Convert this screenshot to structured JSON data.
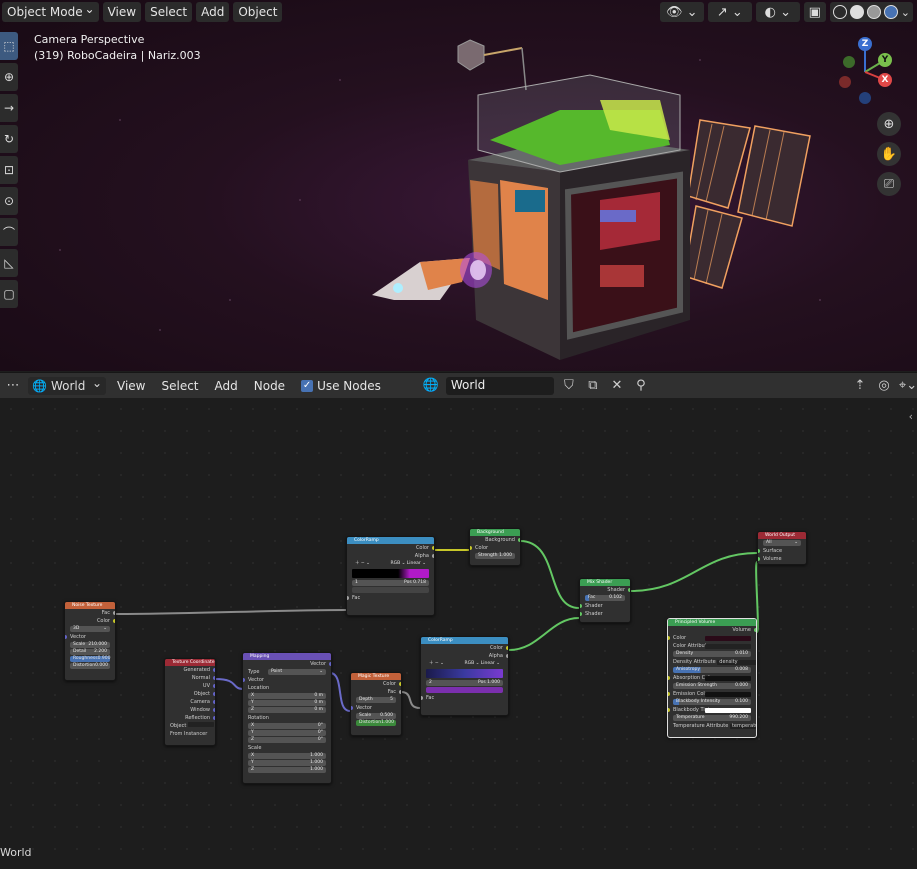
{
  "viewport": {
    "mode_select": "Object Mode",
    "menu": [
      "View",
      "Select",
      "Add",
      "Object"
    ],
    "camera_label": "Camera Perspective",
    "object_label": "(319) RoboCadeira | Nariz.003",
    "gizmo": {
      "z": "Z",
      "y": "Y",
      "x": "X"
    }
  },
  "node_editor": {
    "type_select": "World",
    "menu": [
      "View",
      "Select",
      "Add",
      "Node"
    ],
    "use_nodes_label": "Use Nodes",
    "world_name": "World",
    "footer_label": "World"
  },
  "nodes": {
    "noise": {
      "title": "Noise Texture",
      "out_fac": "Fac",
      "out_color": "Color",
      "dim": "3D",
      "in_vector": "Vector",
      "scale": "Scale",
      "scale_val": "210.000",
      "detail": "Detail",
      "detail_val": "2.200",
      "roughness": "Roughness",
      "roughness_val": "0.900",
      "distortion": "Distortion",
      "distortion_val": "0.000"
    },
    "texcoord": {
      "title": "Texture Coordinate",
      "outs": [
        "Generated",
        "Normal",
        "UV",
        "Object",
        "Camera",
        "Window",
        "Reflection"
      ],
      "object": "Object",
      "from_instancer": "From Instancer"
    },
    "mapping": {
      "title": "Mapping",
      "out_vector": "Vector",
      "type": "Type",
      "type_val": "Point",
      "in_vector": "Vector",
      "location": "Location",
      "rotation": "Rotation",
      "scale": "Scale",
      "x": "X",
      "y": "Y",
      "z": "Z",
      "loc_vals": [
        "0 m",
        "0 m",
        "0 m"
      ],
      "rot_vals": [
        "0°",
        "0°",
        "0°"
      ],
      "scale_vals": [
        "1.000",
        "1.000",
        "1.000"
      ]
    },
    "magic": {
      "title": "Magic Texture",
      "out_color": "Color",
      "out_fac": "Fac",
      "depth": "Depth",
      "depth_val": "5",
      "in_vector": "Vector",
      "scale": "Scale",
      "scale_val": "0.500",
      "distortion": "Distortion",
      "distortion_val": "1.000"
    },
    "ramp1": {
      "title": "ColorRamp",
      "out_color": "Color",
      "out_alpha": "Alpha",
      "mode": "RGB",
      "interp": "Linear",
      "idx": "1",
      "pos": "Pos",
      "pos_val": "0.718",
      "in_fac": "Fac"
    },
    "ramp2": {
      "title": "ColorRamp",
      "out_color": "Color",
      "out_alpha": "Alpha",
      "mode": "RGB",
      "interp": "Linear",
      "idx": "2",
      "pos": "Pos",
      "pos_val": "1.000",
      "in_fac": "Fac"
    },
    "background": {
      "title": "Background",
      "out": "Background",
      "in_color": "Color",
      "strength": "Strength",
      "strength_val": "1.000"
    },
    "mix": {
      "title": "Mix Shader",
      "out": "Shader",
      "fac": "Fac",
      "fac_val": "0.102",
      "in1": "Shader",
      "in2": "Shader"
    },
    "volume": {
      "title": "Principled Volume",
      "out": "Volume",
      "color": "Color",
      "color_attr": "Color Attribute",
      "density": "Density",
      "density_val": "0.010",
      "density_attr": "Density Attribute",
      "density_attr_val": "density",
      "anisotropy": "Anisotropy",
      "anisotropy_val": "0.008",
      "absorption": "Absorption Color",
      "emission_strength": "Emission Strength",
      "emission_strength_val": "0.000",
      "emission_color": "Emission Color",
      "blackbody_intensity": "Blackbody Intensity",
      "blackbody_intensity_val": "0.100",
      "blackbody_tint": "Blackbody Tint",
      "temperature": "Temperature",
      "temperature_val": "990.200",
      "temperature_attr": "Temperature Attribute",
      "temperature_attr_val": "temperature"
    },
    "output": {
      "title": "World Output",
      "target": "All",
      "surface": "Surface",
      "volume": "Volume"
    }
  },
  "colors": {
    "accent": "#4772b3",
    "texture_header": "#c2613a",
    "shader_header": "#3b9e53",
    "converter_header": "#3c8ec1",
    "vector_header": "#6950b5",
    "output_header": "#9c2a35"
  }
}
